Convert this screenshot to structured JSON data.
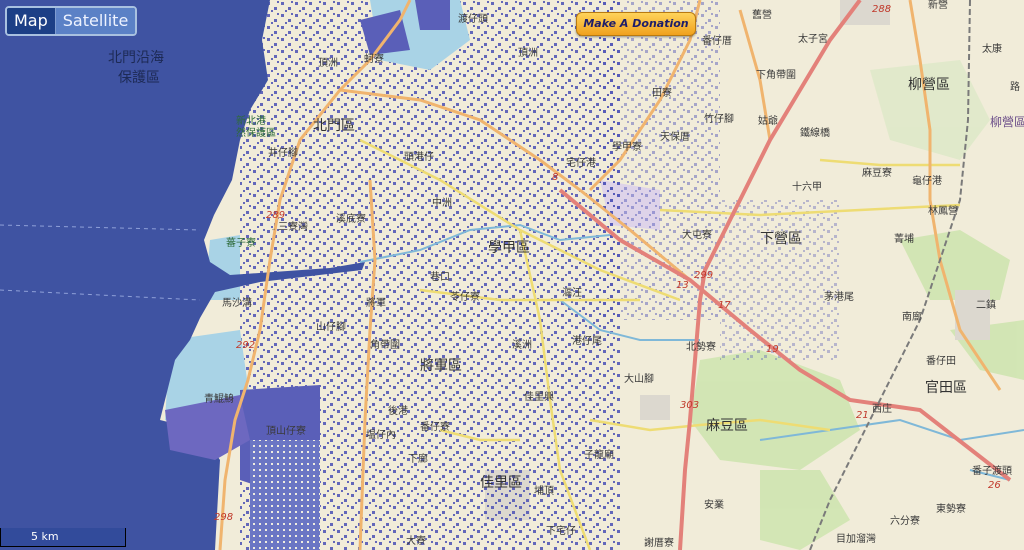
{
  "map_type_control": {
    "map_label": "Map",
    "satellite_label": "Satellite",
    "selected": "Map"
  },
  "donate_button": {
    "label": "Make A Donation"
  },
  "scale_bar": {
    "label": "5 km"
  },
  "colors": {
    "sea": "#3f53a2",
    "flood_overlay": "#4a4fb5",
    "land": "#f1ecd9",
    "water_light": "#a9d3e6",
    "highway": "#e3817a",
    "main_road": "#f0b46e",
    "secondary_road": "#eedc73",
    "district_label": "#6a4c88"
  },
  "map": {
    "district_labels": [
      "北門區",
      "學甲區",
      "將軍區",
      "佳里區",
      "麻豆區",
      "下營區",
      "柳營區",
      "官田區"
    ],
    "place_labels": [
      "北門沿海",
      "保護區",
      "新北港",
      "然保護區",
      "井仔腳",
      "頂洲",
      "蚵寮",
      "渡仔頭",
      "頂洲",
      "舊營",
      "太子宮",
      "新營",
      "太康",
      "下角帶圍",
      "柳營區",
      "路",
      "番仔厝",
      "田寮",
      "竹仔腳",
      "姑爺",
      "頭港仔",
      "宅仔港",
      "學甲寮",
      "天保厝",
      "鐵線橋",
      "中洲",
      "溪底寮",
      "三寮灣",
      "崁仔頭",
      "十六甲",
      "麻豆寮",
      "龜仔港",
      "大屯寮",
      "菁埔",
      "林鳳營",
      "蕃子寮",
      "二鎮",
      "茅港尾",
      "巷口",
      "將軍",
      "苓仔寮",
      "山仔腳",
      "角帶圍",
      "港仔尾",
      "北勢寮",
      "南廍",
      "番仔田",
      "漚汪",
      "溪洲",
      "大山腳",
      "佳里興",
      "青鯤鯓",
      "後港",
      "番仔寮",
      "頂山仔寮",
      "塭仔內",
      "謝厝寮",
      "子龍廟",
      "下廍",
      "番子渡頭",
      "六分寮",
      "東勢寮",
      "下宅仔",
      "大寮",
      "安業",
      "目加溜灣",
      "埔頂",
      "西庄",
      "馬沙溝",
      "佳里區",
      "麻豆區"
    ],
    "road_shields": [
      "288",
      "289",
      "292",
      "298",
      "8",
      "13",
      "17",
      "19",
      "21",
      "26",
      "299",
      "303"
    ]
  }
}
